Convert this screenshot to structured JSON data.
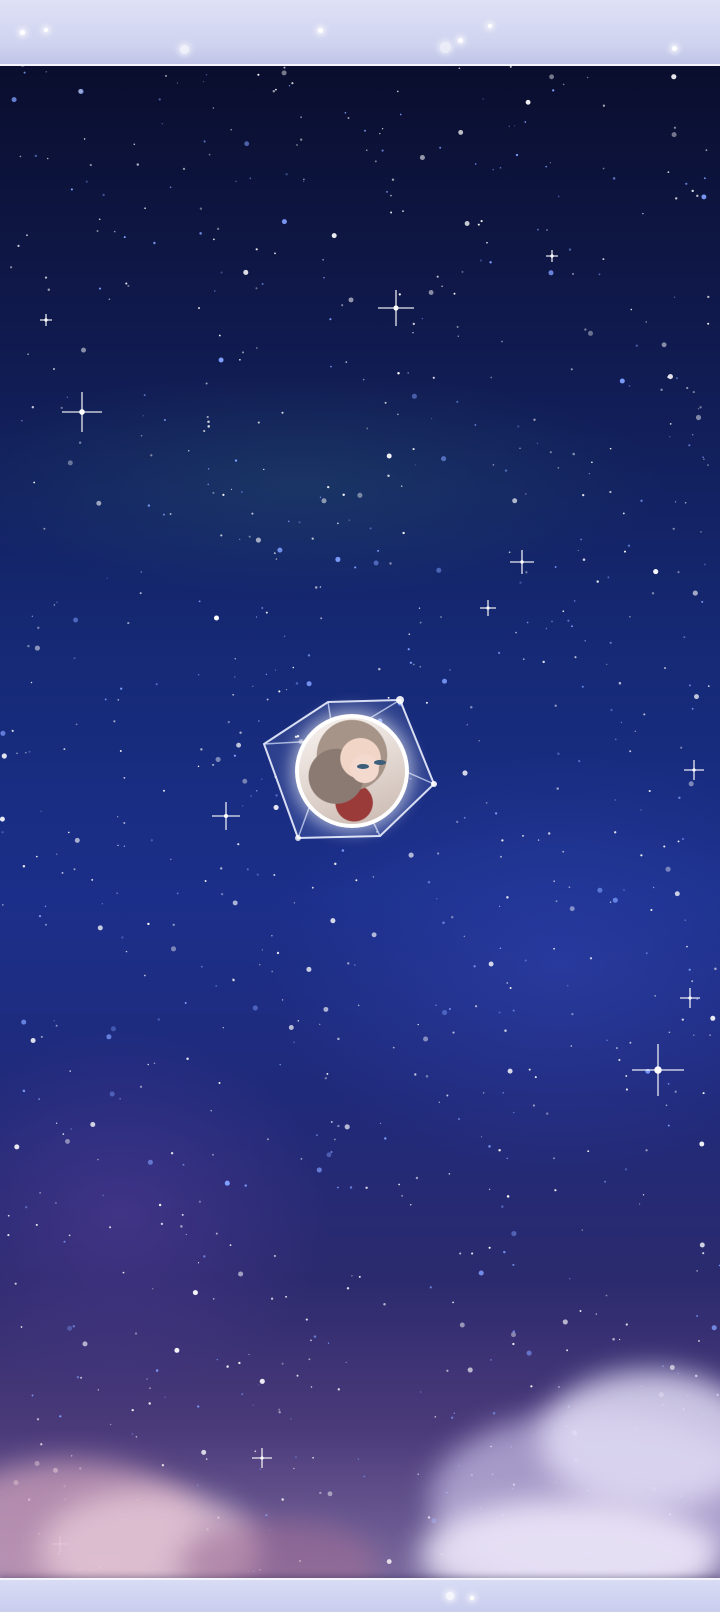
{
  "scene": {
    "name": "starry-night-sky",
    "colors": {
      "frame": "#d4d7f1",
      "sky_top": "#0a0e2e",
      "sky_mid": "#1b2f8a",
      "sky_bottom": "#7a6a9e",
      "cloud": "#e8e2f2"
    }
  },
  "avatar": {
    "icon": "character-portrait-icon",
    "frame": "crystal-cube"
  }
}
